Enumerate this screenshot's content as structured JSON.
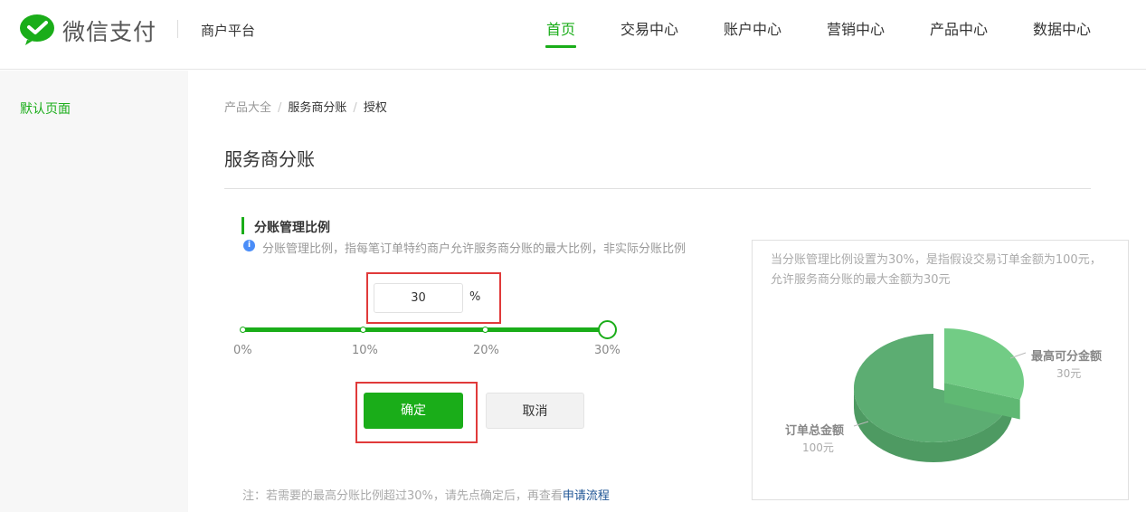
{
  "header": {
    "brand": "微信支付",
    "platform": "商户平台",
    "nav": [
      "首页",
      "交易中心",
      "账户中心",
      "营销中心",
      "产品中心",
      "数据中心"
    ],
    "active_nav": "首页",
    "accent_color": "#1aad19"
  },
  "sidebar": {
    "items": [
      {
        "label": "默认页面"
      }
    ]
  },
  "breadcrumb": [
    "产品大全",
    "服务商分账",
    "授权"
  ],
  "page_title": "服务商分账",
  "section": {
    "title": "分账管理比例",
    "info": "分账管理比例，指每笔订单特约商户允许服务商分账的最大比例，非实际分账比例",
    "info_icon": "info-icon"
  },
  "ratio": {
    "value": "30",
    "unit": "%",
    "slider_value_percent": 30,
    "slider_max_percent": 30
  },
  "slider_ticks": [
    "0%",
    "10%",
    "20%",
    "30%"
  ],
  "buttons": {
    "confirm": "确定",
    "cancel": "取消"
  },
  "note": {
    "text": "注：若需要的最高分账比例超过30%，请先点确定后，再查看",
    "link": "申请流程"
  },
  "panel": {
    "text": "当分账管理比例设置为30%，是指假设交易订单金额为100元，允许服务商分账的最大金额为30元",
    "pie_label_max": "最高可分金额",
    "pie_value_max": "30元",
    "pie_label_total": "订单总金额",
    "pie_value_total": "100元"
  },
  "chart_data": {
    "type": "pie",
    "categories": [
      "最高可分金额",
      "订单总金额"
    ],
    "values": [
      30,
      70
    ],
    "value_labels": [
      "30元",
      "100元"
    ],
    "colors": [
      "#72cc85",
      "#5cad72"
    ]
  },
  "highlight_color": "#e03a3a"
}
